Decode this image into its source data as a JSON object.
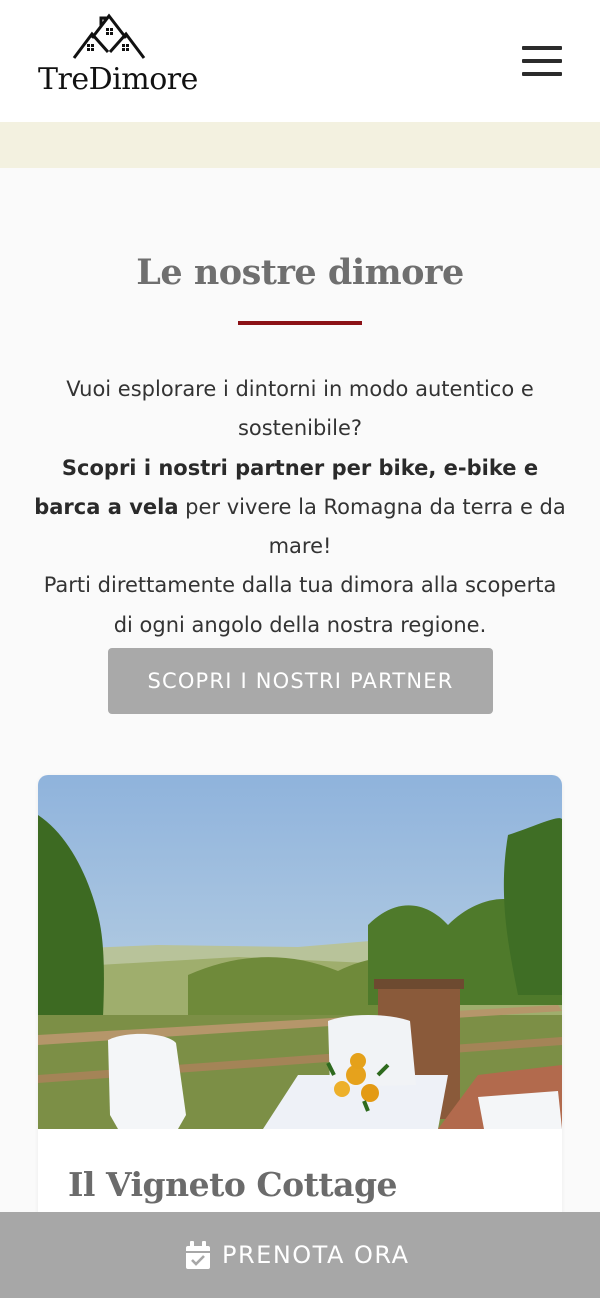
{
  "header": {
    "logo_text": "TreDimore",
    "logo_icon": "three-houses-icon",
    "menu_icon": "hamburger-menu-icon"
  },
  "section": {
    "title": "Le nostre dimore",
    "intro_line1": "Vuoi esplorare i dintorni in modo autentico e sostenibile?",
    "intro_bold": "Scopri i nostri partner per bike, e-bike e barca a vela",
    "intro_line2_rest": " per vivere la Romagna da terra e da mare!",
    "intro_line3": "Parti direttamente dalla tua dimora alla scoperta di ogni angolo della nostra regione.",
    "cta_label": "SCOPRI I NOSTRI PARTNER"
  },
  "card": {
    "title": "Il Vigneto Cottage"
  },
  "booking": {
    "label": "PRENOTA ORA",
    "icon": "calendar-check-icon"
  },
  "colors": {
    "accent_rule": "#8b1116",
    "cta_bg": "#a9a9a9",
    "band_bg": "#f3f1e0"
  }
}
